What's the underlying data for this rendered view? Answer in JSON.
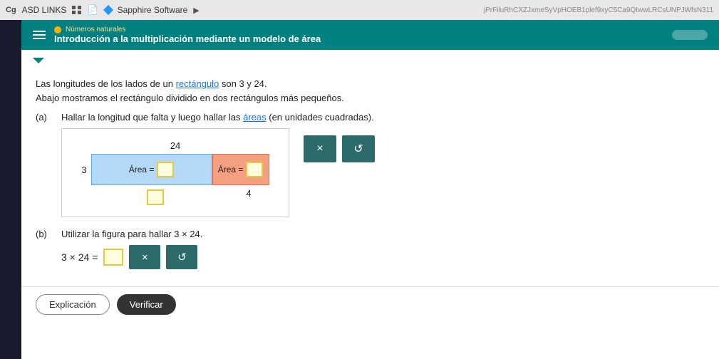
{
  "browser": {
    "tab_icon": "Cg",
    "tab_asd_links": "ASD LINKS",
    "tab_sapphire": "Sapphire Software",
    "tab_arrow": "▶"
  },
  "header": {
    "subtitle": "Números naturales",
    "title": "Introducción a la multiplicación mediante un modelo de área",
    "dot_color": "#ffb300"
  },
  "intro": {
    "line1": "Las longitudes de los lados de un ",
    "link1": "rectángulo",
    "line1b": " son 3 y 24.",
    "line2": "Abajo mostramos el rectángulo dividido en dos rectángulos más pequeños."
  },
  "question_a": {
    "label": "(a)",
    "text": "Hallar la longitud que falta y luego hallar las ",
    "link": "áreas",
    "text2": " (en unidades cuadradas)."
  },
  "diagram": {
    "top_number": "24",
    "left_number": "3",
    "blue_label": "Área = ",
    "salmon_label": "Área = ",
    "bottom_right": "4"
  },
  "buttons_a": {
    "x_label": "×",
    "undo_label": "↺"
  },
  "question_b": {
    "label": "(b)",
    "text": "Utilizar la figura para hallar 3 × 24."
  },
  "equation": {
    "text": "3 × 24 = "
  },
  "buttons_b": {
    "x_label": "×",
    "undo_label": "↺"
  },
  "footer": {
    "explicacion": "Explicación",
    "verificar": "Verificar"
  }
}
